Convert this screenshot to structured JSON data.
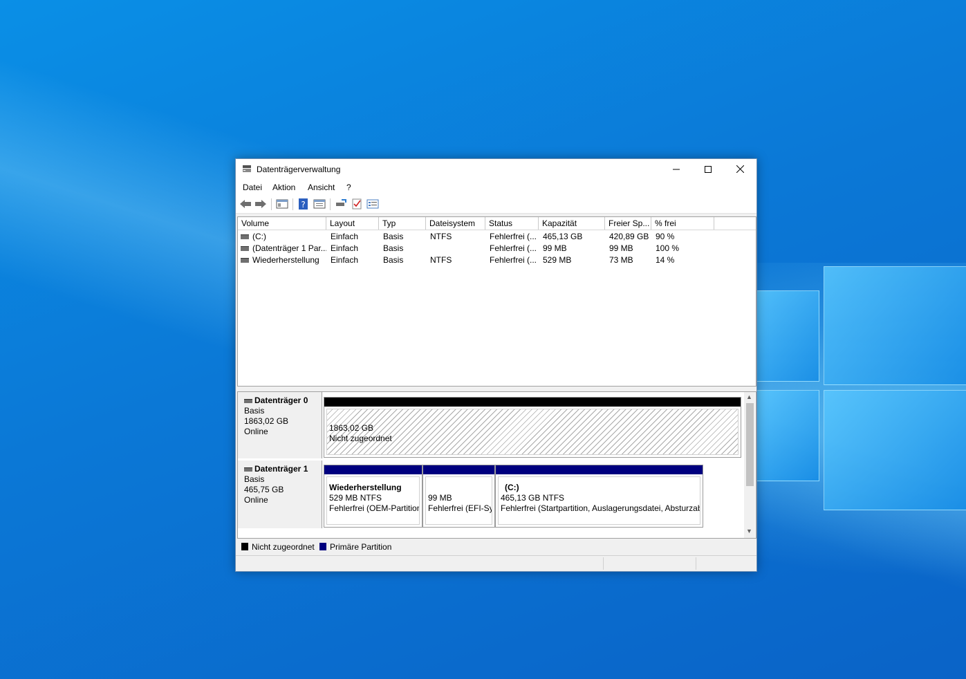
{
  "window": {
    "title": "Datenträgerverwaltung"
  },
  "menu": [
    "Datei",
    "Aktion",
    "Ansicht",
    "?"
  ],
  "toolbar": {
    "icons": [
      "back-arrow-icon",
      "forward-arrow-icon",
      "console-tree-icon",
      "help-icon",
      "properties-icon",
      "connect-icon",
      "check-icon",
      "settings-list-icon"
    ]
  },
  "volumes": {
    "columns": [
      "Volume",
      "Layout",
      "Typ",
      "Dateisystem",
      "Status",
      "Kapazität",
      "Freier Sp...",
      "% frei"
    ],
    "rows": [
      [
        "(C:)",
        "Einfach",
        "Basis",
        "NTFS",
        "Fehlerfrei (...",
        "465,13 GB",
        "420,89 GB",
        "90 %"
      ],
      [
        "(Datenträger 1 Par...",
        "Einfach",
        "Basis",
        "",
        "Fehlerfrei (...",
        "99 MB",
        "99 MB",
        "100 %"
      ],
      [
        "Wiederherstellung",
        "Einfach",
        "Basis",
        "NTFS",
        "Fehlerfrei (...",
        "529 MB",
        "73 MB",
        "14 %"
      ]
    ]
  },
  "disks": [
    {
      "name": "Datenträger 0",
      "type": "Basis",
      "size": "1863,02 GB",
      "state": "Online",
      "partitions": [
        {
          "title": "",
          "line1": "1863,02 GB",
          "line2": "Nicht zugeordnet"
        }
      ]
    },
    {
      "name": "Datenträger 1",
      "type": "Basis",
      "size": "465,75 GB",
      "state": "Online",
      "partitions": [
        {
          "title": "Wiederherstellung",
          "line1": "529 MB NTFS",
          "line2": "Fehlerfrei (OEM-Partition)"
        },
        {
          "title": "",
          "line1": "99 MB",
          "line2": "Fehlerfrei (EFI-Systempartition)"
        },
        {
          "title": "(C:)",
          "line1": "465,13 GB NTFS",
          "line2": "Fehlerfrei (Startpartition, Auslagerungsdatei, Absturzabbild, Primäre Partition)"
        }
      ]
    }
  ],
  "legend": {
    "unallocated": "Nicht zugeordnet",
    "primary": "Primäre Partition",
    "colors": {
      "unallocated": "#000000",
      "primary": "#00007f"
    }
  }
}
